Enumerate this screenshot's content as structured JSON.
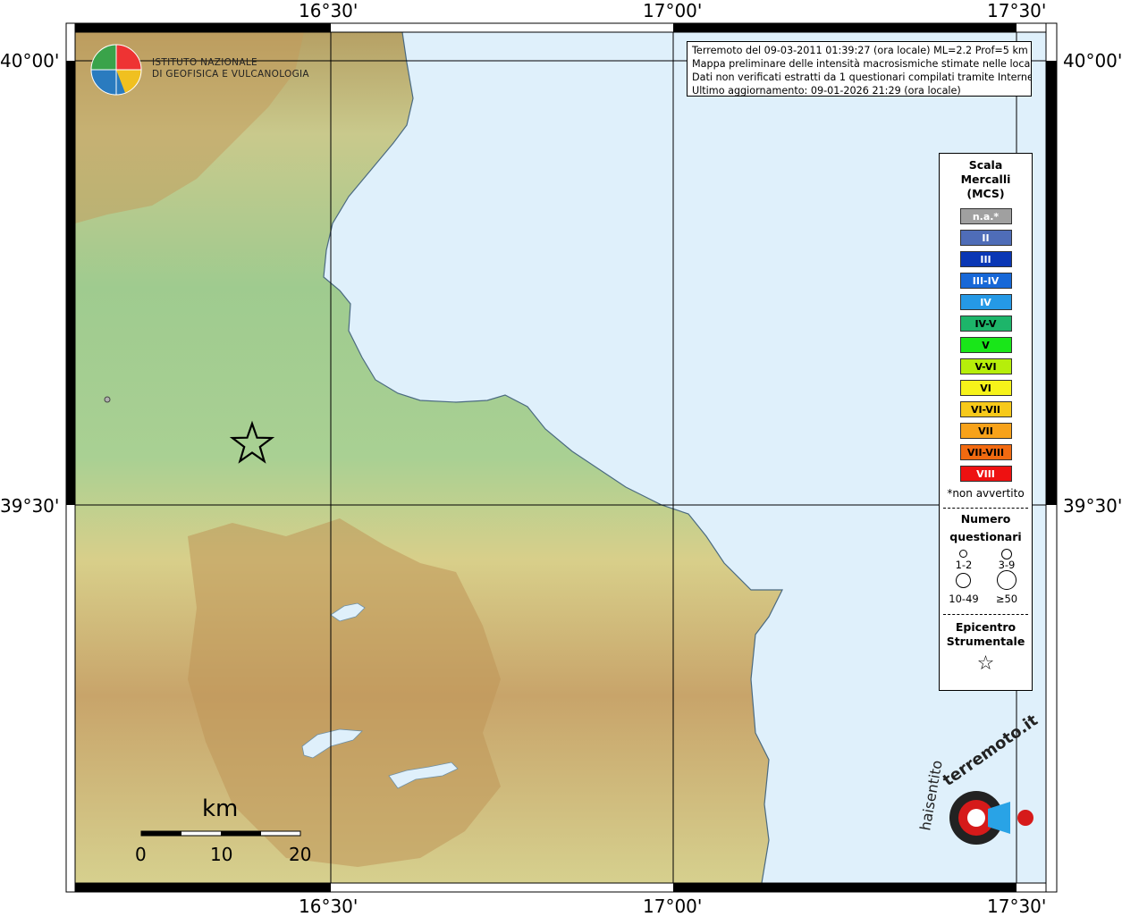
{
  "coords": {
    "top": [
      "16°30'",
      "17°00'",
      "17°30'"
    ],
    "bottom": [
      "16°30'",
      "17°00'",
      "17°30'"
    ],
    "left": [
      "40°00'",
      "39°30'"
    ],
    "right": [
      "40°00'",
      "39°30'"
    ]
  },
  "info": {
    "line1": "Terremoto del 09-03-2011 01:39:27 (ora locale) ML=2.2 Prof=5 km",
    "line2": "Mappa preliminare delle intensità macrosismiche stimate nelle località",
    "line3": "Dati non verificati estratti da 1 questionari compilati tramite Internet.",
    "line4": "Ultimo aggiornamento: 09-01-2026 21:29 (ora locale)"
  },
  "legend": {
    "title1": "Scala",
    "title2": "Mercalli",
    "title3": "(MCS)",
    "scale": [
      {
        "label": "n.a.*",
        "color": "#a0a0a0",
        "text": "#ffffff"
      },
      {
        "label": "II",
        "color": "#4f6db8",
        "text": "#ffffff"
      },
      {
        "label": "III",
        "color": "#0a37b5",
        "text": "#ffffff"
      },
      {
        "label": "III-IV",
        "color": "#1768d8",
        "text": "#ffffff"
      },
      {
        "label": "IV",
        "color": "#2599e6",
        "text": "#ffffff"
      },
      {
        "label": "IV-V",
        "color": "#1db56a",
        "text": "#000000"
      },
      {
        "label": "V",
        "color": "#19e619",
        "text": "#000000"
      },
      {
        "label": "V-VI",
        "color": "#b6ee0a",
        "text": "#000000"
      },
      {
        "label": "VI",
        "color": "#f6f31a",
        "text": "#000000"
      },
      {
        "label": "VI-VII",
        "color": "#f7c91a",
        "text": "#000000"
      },
      {
        "label": "VII",
        "color": "#f7a21a",
        "text": "#000000"
      },
      {
        "label": "VII-VIII",
        "color": "#f26a10",
        "text": "#000000"
      },
      {
        "label": "VIII",
        "color": "#ee1111",
        "text": "#ffffff"
      }
    ],
    "note": "*non avvertito",
    "count_title1": "Numero",
    "count_title2": "questionari",
    "counts": [
      "1-2",
      "3-9",
      "10-49",
      "≥50"
    ],
    "epi_title1": "Epicentro",
    "epi_title2": "Strumentale"
  },
  "institute": {
    "line1": "ISTITUTO NAZIONALE",
    "line2": "DI GEOFISICA E VULCANOLOGIA"
  },
  "scalebar": {
    "unit": "km",
    "ticks": [
      "0",
      "10",
      "20"
    ]
  },
  "colors": {
    "sea": "#dff0fb",
    "land_low": "#9fcb8f",
    "land_mid": "#d8d18c",
    "land_high": "#c39a5c",
    "peak": "#e8e2d6"
  }
}
